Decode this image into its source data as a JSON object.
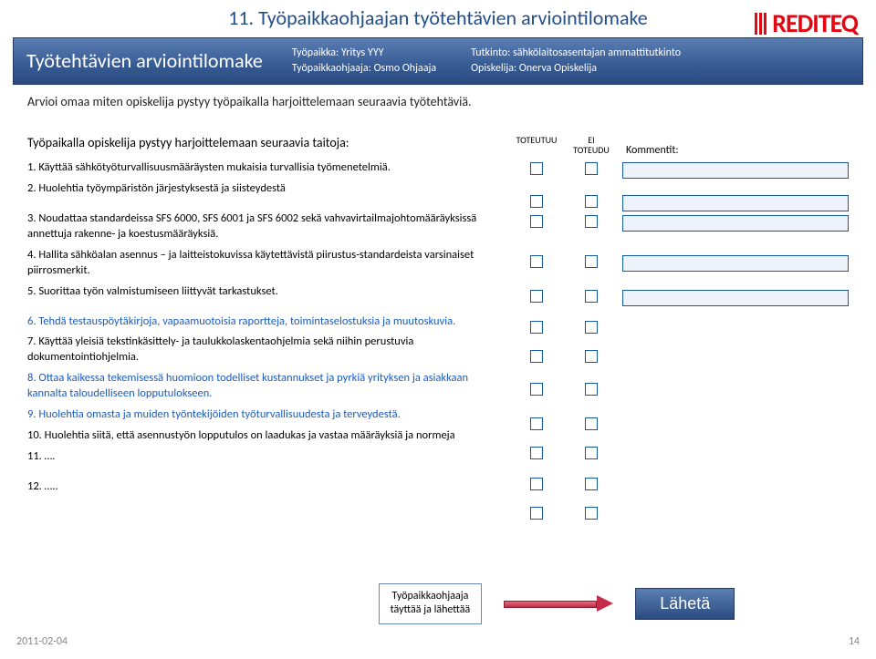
{
  "page": {
    "title": "11. Työpaikkaohjaajan työtehtävien arviointilomake",
    "footer_date": "2011-02-04",
    "footer_page": "14"
  },
  "logo": {
    "text": "REDITEQ"
  },
  "banner": {
    "form_title": "Työtehtävien arviointilomake",
    "mid": {
      "line1_label": "Työpaikka:",
      "line1_value": "Yritys YYY",
      "line2_label": "Työpaikkaohjaaja:",
      "line2_value": "Osmo Ohjaaja"
    },
    "right": {
      "line1_label": "Tutkinto:",
      "line1_value": "sähkölaitosasentajan ammattitutkinto",
      "line2_label": "Opiskelija:",
      "line2_value": "Onerva Opiskelija"
    }
  },
  "intro": "Arvioi omaa miten opiskelija pystyy työpaikalla harjoittelemaan seuraavia työtehtäviä.",
  "section_heading": "Työpaikalla opiskelija pystyy harjoittelemaan seuraavia taitoja:",
  "columns": {
    "col1": "TOTEUTUU",
    "col2_line1": "EI",
    "col2_line2": "TOTEUDU",
    "comments": "Kommentit:"
  },
  "items": {
    "i1": "1. Käyttää sähkötyöturvallisuusmääräysten mukaisia turvallisia työmenetelmiä.",
    "i2": "2. Huolehtia työympäristön järjestyksestä ja siisteydestä",
    "i3": "3. Noudattaa standardeissa SFS 6000, SFS 6001 ja SFS 6002 sekä vahvavirtailmajohtomääräyksissä annettuja rakenne- ja koestusmääräyksiä.",
    "i4": "4. Hallita sähköalan asennus – ja laitteistokuvissa käytettävistä piirustus-standardeista varsinaiset piirrosmerkit.",
    "i5": "5. Suorittaa työn valmistumiseen liittyvät tarkastukset.",
    "i6": "6. Tehdä testauspöytäkirjoja, vapaamuotoisia raportteja, toimintaselostuksia ja muutoskuvia.",
    "i7": "7. Käyttää yleisiä tekstinkäsittely- ja taulukkolaskentaohjelmia sekä niihin perustuvia dokumentointiohjelmia.",
    "i8": "8. Ottaa kaikessa tekemisessä huomioon todelliset kustannukset ja pyrkiä yrityksen ja asiakkaan kannalta taloudelliseen lopputulokseen.",
    "i9": "9. Huolehtia omasta ja muiden työntekijöiden työturvallisuudesta ja terveydestä.",
    "i10": "10. Huolehtia siitä, että asennustyön lopputulos on laadukas ja vastaa määräyksiä ja normeja",
    "i11": "11. ….",
    "i12": "12. ….."
  },
  "bottom": {
    "note_line1": "Työpaikkaohjaaja",
    "note_line2": "täyttää ja lähettää",
    "send": "Lähetä"
  }
}
